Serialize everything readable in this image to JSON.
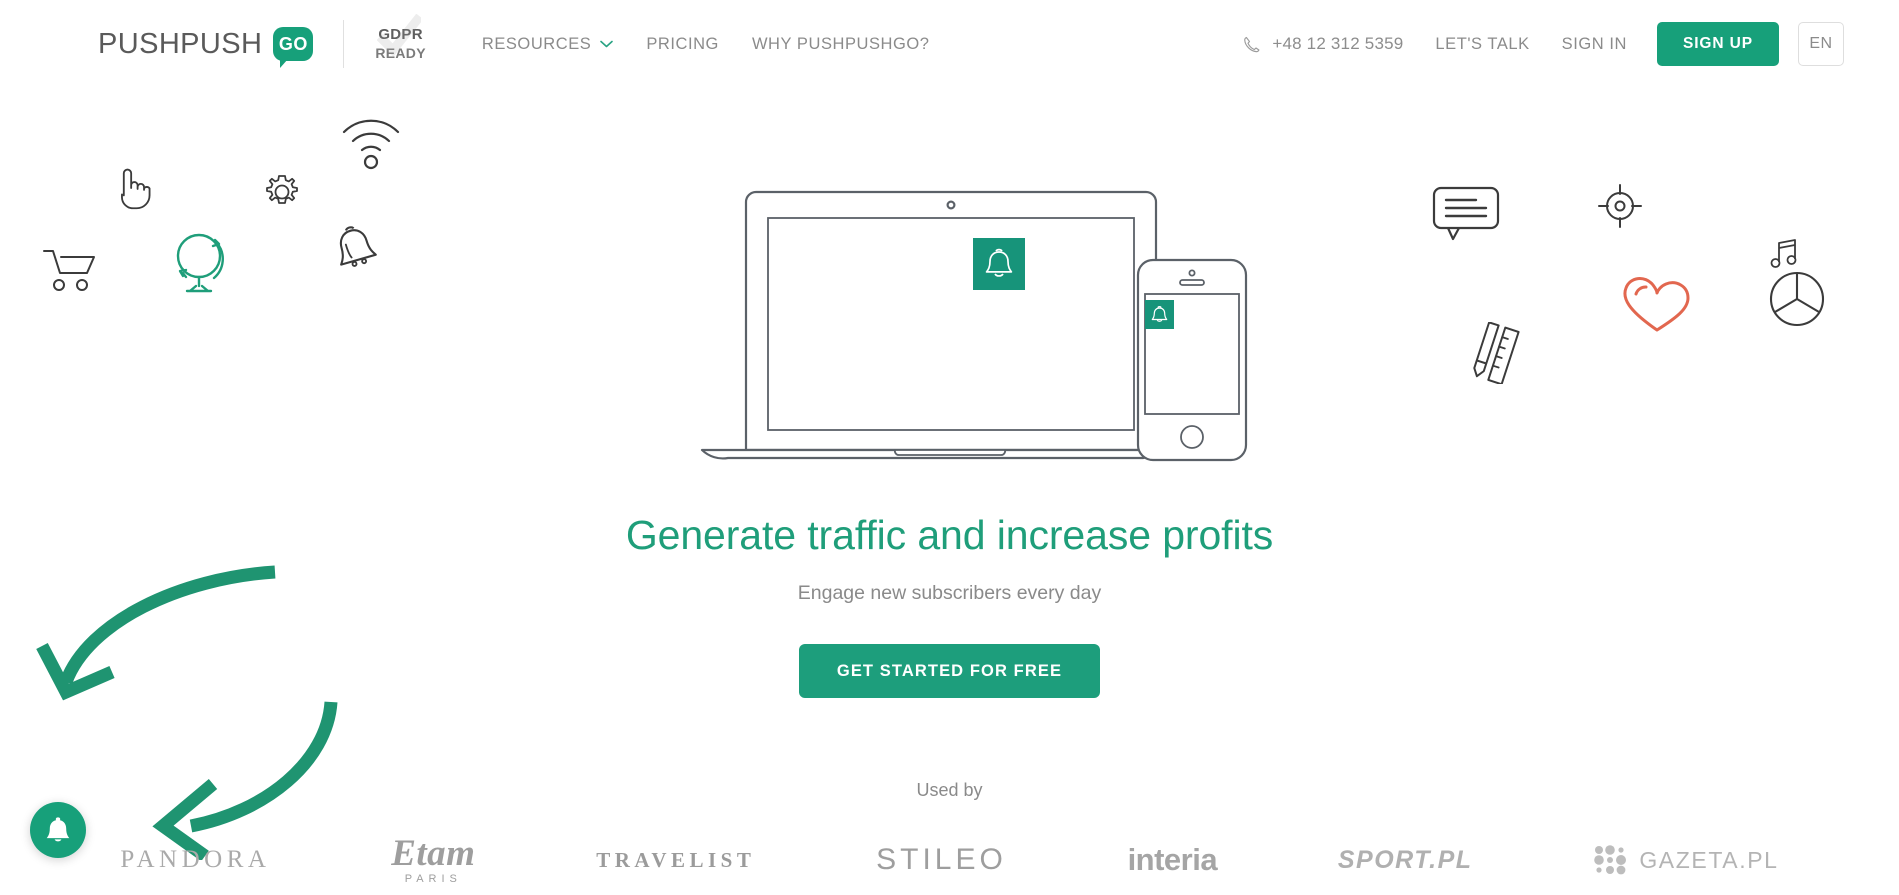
{
  "header": {
    "logo": {
      "word": "PUSHPUSH",
      "badge": "GO",
      "badge_icon": "speech-bubble-icon"
    },
    "gdpr": {
      "line1": "GDPR",
      "line2": "READY",
      "icon": "check-mark-icon"
    },
    "nav": [
      {
        "label": "RESOURCES",
        "has_dropdown": true,
        "caret_icon": "chevron-down-icon"
      },
      {
        "label": "PRICING",
        "has_dropdown": false
      },
      {
        "label": "WHY PUSHPUSHGO?",
        "has_dropdown": false
      }
    ],
    "phone": {
      "icon": "phone-icon",
      "number": "+48 12 312 5359"
    },
    "lets_talk": "LET'S TALK",
    "sign_in": "SIGN IN",
    "sign_up": "SIGN UP",
    "language": "EN"
  },
  "hero": {
    "title": "Generate traffic and increase profits",
    "subtitle": "Engage new subscribers every day",
    "cta": "GET STARTED FOR FREE",
    "illustration": {
      "laptop_icon": "laptop-icon",
      "phone_icon": "smartphone-icon",
      "laptop_badge_icon": "bell-icon",
      "phone_badge_icon": "bell-icon"
    }
  },
  "social_proof": {
    "label": "Used by",
    "brands": [
      {
        "name": "PANDORA"
      },
      {
        "name": "Etam",
        "sub": "PARIS"
      },
      {
        "name": "TRAVELIST"
      },
      {
        "name": "STILEO"
      },
      {
        "name": "interia"
      },
      {
        "name": "SPORT.PL"
      },
      {
        "name": "GAZETA.PL",
        "icon": "dot-matrix-icon"
      }
    ]
  },
  "decorations": {
    "icons": [
      {
        "name": "shopping-cart-icon",
        "color": "#3b3b3b"
      },
      {
        "name": "pointing-hand-icon",
        "color": "#3b3b3b"
      },
      {
        "name": "globe-icon",
        "color": "#1f9e7a"
      },
      {
        "name": "gear-icon",
        "color": "#3b3b3b"
      },
      {
        "name": "wifi-icon",
        "color": "#3b3b3b"
      },
      {
        "name": "bell-icon",
        "color": "#3b3b3b"
      },
      {
        "name": "chat-bubble-icon",
        "color": "#3b3b3b"
      },
      {
        "name": "crosshair-icon",
        "color": "#3b3b3b"
      },
      {
        "name": "music-note-icon",
        "color": "#3b3b3b"
      },
      {
        "name": "pencil-ruler-icon",
        "color": "#3b3b3b"
      },
      {
        "name": "heart-icon",
        "color": "#e2674f"
      },
      {
        "name": "pie-chart-icon",
        "color": "#3b3b3b"
      }
    ],
    "arrows": [
      {
        "name": "curved-arrow-down-left",
        "color": "#1f9471"
      },
      {
        "name": "curved-arrow-left",
        "color": "#1f9471"
      }
    ]
  },
  "fab": {
    "icon": "bell-icon",
    "color": "#17a07a"
  },
  "theme": {
    "brand_green": "#17a07a",
    "title_green": "#1f9e7a",
    "heart_red": "#e2674f",
    "text_gray": "#8b8b8b",
    "icon_gray": "#3b3b3b"
  }
}
